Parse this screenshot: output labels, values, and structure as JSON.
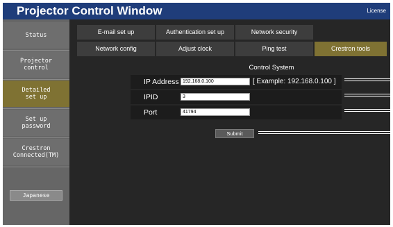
{
  "window": {
    "title": "Projector Control Window",
    "license_link": "License"
  },
  "sidebar": {
    "items": [
      {
        "label": "Status"
      },
      {
        "label": "Projector\ncontrol"
      },
      {
        "label": "Detailed\nset up"
      },
      {
        "label": "Set up\npassword"
      },
      {
        "label": "Crestron\nConnected(TM)"
      }
    ],
    "language_button": "Japanese"
  },
  "tabs": {
    "row1": [
      "E-mail set up",
      "Authentication set up",
      "Network security"
    ],
    "row2": [
      "Network config",
      "Adjust clock",
      "Ping test",
      "Crestron tools"
    ]
  },
  "control_system": {
    "title": "Control System",
    "ip_address": {
      "label": "IP Address",
      "value": "192.168.0.100",
      "example": "[ Example: 192.168.0.100 ]"
    },
    "ipid": {
      "label": "IPID",
      "value": "3"
    },
    "port": {
      "label": "Port",
      "value": "41794"
    },
    "submit_label": "Submit"
  },
  "colors": {
    "title_bar": "#1f3d7a",
    "active": "#7f7233"
  }
}
